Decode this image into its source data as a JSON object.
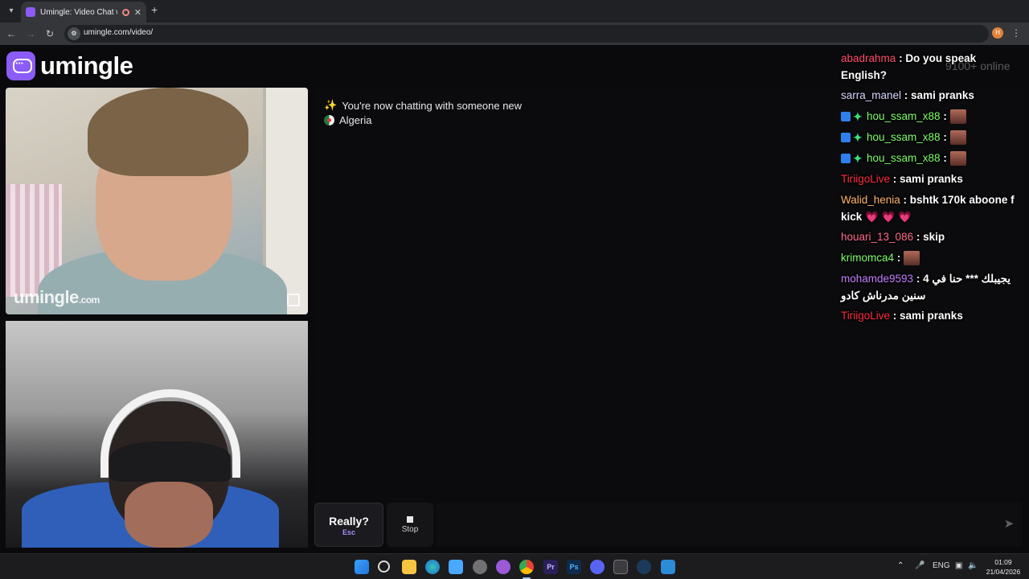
{
  "browser": {
    "tab_title": "Umingle: Video Chat with S",
    "url": "umingle.com/video/",
    "profile_initial": "H"
  },
  "site": {
    "logo_text": "umingle",
    "online_text": "9100+ online",
    "watermark_main": "umingle",
    "watermark_suffix": ".com"
  },
  "chat": {
    "system_message": "You're now chatting with someone new",
    "country": "Algeria"
  },
  "controls": {
    "really_label": "Really?",
    "really_hint": "Esc",
    "stop_label": "Stop",
    "input_value": ""
  },
  "overlay_chat": {
    "messages": [
      {
        "user": "abadrahma",
        "user_color": "#ff4d6d",
        "text": "Do you speak English?"
      },
      {
        "user": "sarra_manel",
        "user_color": "#d7d7ff",
        "text": "sami pranks"
      },
      {
        "user": "hou_ssam_x88",
        "user_color": "#7dff6a",
        "text": "",
        "badges": true,
        "emote": true
      },
      {
        "user": "hou_ssam_x88",
        "user_color": "#7dff6a",
        "text": "",
        "badges": true,
        "emote": true
      },
      {
        "user": "hou_ssam_x88",
        "user_color": "#7dff6a",
        "text": "",
        "badges": true,
        "emote": true
      },
      {
        "user": "TiriigoLive",
        "user_color": "#ff2a3c",
        "text": "sami pranks"
      },
      {
        "user": "Walid_henia",
        "user_color": "#ffb56b",
        "text": "bshtk 170k aboone f kick",
        "hearts": "💗 💗 💗"
      },
      {
        "user": "houari_13_086",
        "user_color": "#ff6b8a",
        "text": "skip"
      },
      {
        "user": "krimomca4",
        "user_color": "#7dff6a",
        "text": "",
        "emote": true
      },
      {
        "user": "mohamde9593",
        "user_color": "#c77dff",
        "text": "يجيبلك *** حنا في 4 سنين مدرناش كادو"
      },
      {
        "user": "TiriigoLive",
        "user_color": "#ff2a3c",
        "text": "sami pranks"
      }
    ]
  },
  "taskbar": {
    "language": "ENG",
    "time": "01:09",
    "date": "21/04/2026"
  },
  "colors": {
    "brand": "#8b5cf6",
    "page_bg": "#0a0a0c",
    "hint_accent": "#a78bfa"
  },
  "icons": [
    "tab-list-icon",
    "site-favicon",
    "recording-icon",
    "close-icon",
    "new-tab-icon",
    "back-icon",
    "forward-icon",
    "reload-icon",
    "site-info-icon",
    "menu-icon",
    "umingle-logo-icon",
    "sparkle-icon",
    "algeria-flag-icon",
    "report-icon",
    "stop-icon",
    "send-icon",
    "windows-start-icon",
    "search-icon",
    "file-explorer-icon",
    "edge-icon",
    "store-icon",
    "chrome-icon",
    "premiere-icon",
    "photoshop-icon",
    "discord-icon",
    "media-player-icon",
    "steam-icon",
    "chevron-up-icon",
    "microphone-icon",
    "network-icon",
    "volume-icon"
  ]
}
